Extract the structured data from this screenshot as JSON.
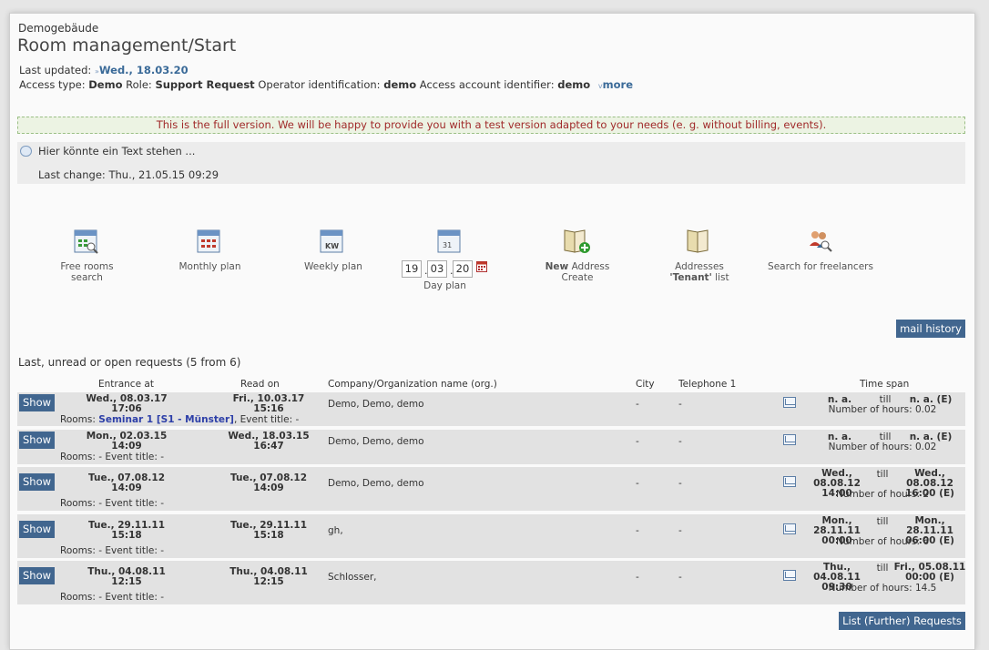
{
  "header": {
    "building": "Demogebäude",
    "title": "Room management/Start",
    "last_updated_label": "Last updated:",
    "last_updated_value": "Wed., 18.03.20",
    "access_type_label": "Access type:",
    "access_type_value": "Demo",
    "role_label": "Role:",
    "role_value": "Support Request",
    "operator_label": "Operator identification:",
    "operator_value": "demo",
    "account_label": "Access account identifier:",
    "account_value": "demo",
    "more_label": "more"
  },
  "notice": "This is the full version. We will be happy to provide you with a test version adapted to your needs (e. g. without billing, events).",
  "info": {
    "text": "Hier könnte ein Text stehen ...",
    "last_change": "Last change: Thu., 21.05.15 09:29"
  },
  "quick_actions": {
    "free_rooms_1": "Free rooms",
    "free_rooms_2": "search",
    "monthly": "Monthly plan",
    "weekly": "Weekly plan",
    "kw": "KW",
    "day_d": "19",
    "day_m": "03",
    "day_y": "20",
    "day_label": "Day plan",
    "new_bold": "New",
    "new_rest": "Address",
    "new_line2": "Create",
    "addr_line1": "Addresses",
    "addr_tenant": "'Tenant'",
    "addr_list": "list",
    "freelancers": "Search for freelancers"
  },
  "mail_history": "mail history",
  "requests": {
    "title": "Last, unread or open requests (5 from 6)",
    "headers": {
      "entrance": "Entrance at",
      "read_on": "Read on",
      "company": "Company/Organization name (org.)",
      "city": "City",
      "telephone": "Telephone 1",
      "time_span": "Time span"
    },
    "show_label": "Show",
    "till": "till",
    "rows": [
      {
        "entrance_date": "Wed., 08.03.17",
        "entrance_time": "17:06",
        "read_date": "Fri., 10.03.17",
        "read_time": "15:16",
        "company": "Demo, Demo, demo",
        "city": "-",
        "phone": "-",
        "rooms_prefix": "Rooms:",
        "room_link": "Seminar 1 [S1 - Münster]",
        "rooms_suffix": ", Event title: -",
        "from_1": "n. a.",
        "from_2": "",
        "to_1": "n. a. (E)",
        "to_2": "",
        "hours": "Number of hours: 0.02"
      },
      {
        "entrance_date": "Mon., 02.03.15",
        "entrance_time": "14:09",
        "read_date": "Wed., 18.03.15",
        "read_time": "16:47",
        "company": "Demo, Demo, demo",
        "city": "-",
        "phone": "-",
        "rooms_text": "Rooms: - Event title: -",
        "from_1": "n. a.",
        "from_2": "",
        "to_1": "n. a. (E)",
        "to_2": "",
        "hours": "Number of hours: 0.02"
      },
      {
        "entrance_date": "Tue., 07.08.12",
        "entrance_time": "14:09",
        "read_date": "Tue., 07.08.12",
        "read_time": "14:09",
        "company": "Demo, Demo, demo",
        "city": "-",
        "phone": "-",
        "rooms_text": "Rooms: - Event title: -",
        "from_1": "Wed., 08.08.12",
        "from_2": "14:00",
        "to_1": "Wed., 08.08.12",
        "to_2": "16:00 (E)",
        "hours": "Number of hours: 2"
      },
      {
        "entrance_date": "Tue., 29.11.11",
        "entrance_time": "15:18",
        "read_date": "Tue., 29.11.11",
        "read_time": "15:18",
        "company": "gh,",
        "city": "-",
        "phone": "-",
        "rooms_text": "Rooms: - Event title: -",
        "from_1": "Mon., 28.11.11",
        "from_2": "00:00",
        "to_1": "Mon., 28.11.11",
        "to_2": "06:00 (E)",
        "hours": "Number of hours: 6"
      },
      {
        "entrance_date": "Thu., 04.08.11",
        "entrance_time": "12:15",
        "read_date": "Thu., 04.08.11",
        "read_time": "12:15",
        "company": "Schlosser,",
        "city": "-",
        "phone": "-",
        "rooms_text": "Rooms: - Event title: -",
        "from_1": "Thu., 04.08.11",
        "from_2": "09:30",
        "to_1": "Fri., 05.08.11",
        "to_2": "00:00 (E)",
        "hours": "Number of hours: 14.5"
      }
    ]
  },
  "list_further": "List (Further) Requests"
}
